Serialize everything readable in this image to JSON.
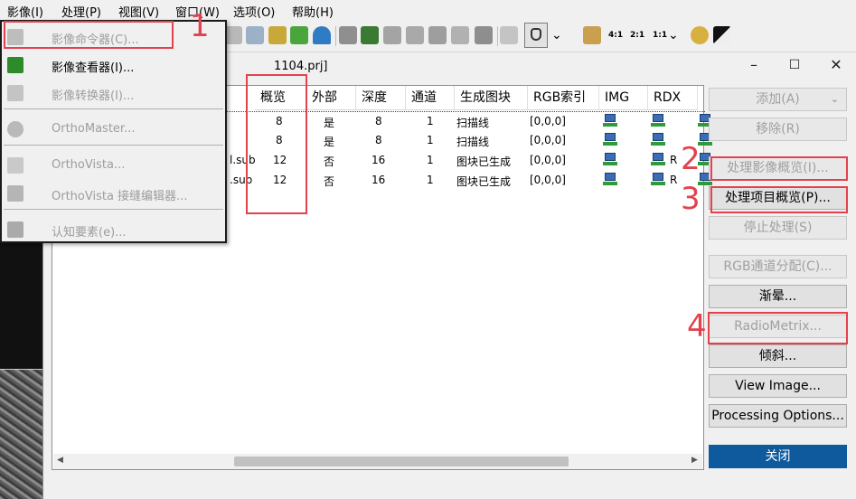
{
  "menubar": {
    "items": [
      "影像(I)",
      "处理(P)",
      "视图(V)",
      "窗口(W)",
      "选项(O)",
      "帮助(H)"
    ]
  },
  "toolbar": {
    "zoom_labels": [
      "4:1",
      "2:1",
      "1:1"
    ],
    "icons": [
      "tool-icon",
      "palette-icon",
      "satellite-icon",
      "tree-icon",
      "sphere-icon",
      "cursor-icon",
      "eye-icon",
      "grid-icon",
      "frame-icon",
      "mosaic-icon",
      "select-icon",
      "hand-icon",
      "cross-icon",
      "settings-icon",
      "contrast-icon"
    ]
  },
  "dialog": {
    "title_fragment": "1104.prj]",
    "controls": [
      "–",
      "☐",
      "✕"
    ]
  },
  "table": {
    "columns": [
      "概览",
      "外部",
      "深度",
      "通道",
      "生成图块",
      "RGB索引",
      "IMG",
      "RDX"
    ],
    "rows": [
      {
        "file": "",
        "overview": "8",
        "external": "是",
        "depth": "8",
        "channels": "1",
        "tiles": "扫描线",
        "rgb": "[0,0,0]",
        "rdx_r": ""
      },
      {
        "file": "",
        "overview": "8",
        "external": "是",
        "depth": "8",
        "channels": "1",
        "tiles": "扫描线",
        "rgb": "[0,0,0]",
        "rdx_r": ""
      },
      {
        "file": "l.sub",
        "overview": "12",
        "external": "否",
        "depth": "16",
        "channels": "1",
        "tiles": "图块已生成",
        "rgb": "[0,0,0]",
        "rdx_r": "R"
      },
      {
        "file": ".sub",
        "overview": "12",
        "external": "否",
        "depth": "16",
        "channels": "1",
        "tiles": "图块已生成",
        "rgb": "[0,0,0]",
        "rdx_r": "R"
      }
    ]
  },
  "right_buttons": {
    "add": "添加(A)",
    "remove": "移除(R)",
    "process_image_overview": "处理影像概览(I)...",
    "process_project_overview": "处理项目概览(P)...",
    "stop_processing": "停止处理(S)",
    "rgb_channel": "RGB通道分配(C)...",
    "vignetting": "渐晕...",
    "radiometrix": "RadioMetrix...",
    "tilt": "倾斜...",
    "view_image": "View Image...",
    "processing_options": "Processing Options...",
    "close": "关闭"
  },
  "dropdown": {
    "items": [
      {
        "label": "影像命令器(C)...",
        "enabled": false,
        "icon": "tool-icon"
      },
      {
        "label": "影像查看器(I)...",
        "enabled": true,
        "icon": "eye-icon"
      },
      {
        "label": "影像转换器(I)...",
        "enabled": false,
        "icon": "convert-icon"
      },
      {
        "label": "OrthoMaster...",
        "enabled": false,
        "icon": "gear-icon"
      },
      {
        "label": "OrthoVista...",
        "enabled": false,
        "icon": "mosaic-icon"
      },
      {
        "label": "OrthoVista 接缝编辑器...",
        "enabled": false,
        "icon": "seam-icon"
      },
      {
        "label": "认知要素(e)...",
        "enabled": false,
        "icon": "feature-icon"
      }
    ]
  },
  "annotations": {
    "numbers": [
      "1",
      "2",
      "3",
      "4"
    ],
    "color": "#e2424e"
  },
  "colors": {
    "accent_primary": "#0e5a9c",
    "annotation_red": "#e2424e"
  }
}
